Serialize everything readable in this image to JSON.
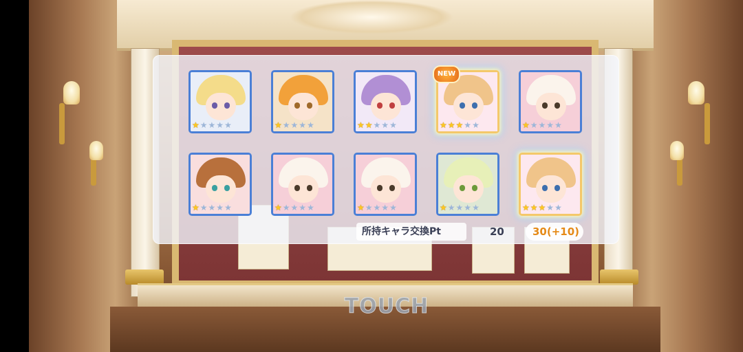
{
  "colors": {
    "card_border_blue": "#4a7fd6",
    "card_border_rainbow": "#f4c86a",
    "star_on": "#ffc81f",
    "star_off": "#9db6d8",
    "pt_after_color": "#e58a18"
  },
  "cards": [
    {
      "name": "blonde-elf-girl",
      "hair": "#f4dc8a",
      "bg": "#e9eef8",
      "eye": "#6b5ca8",
      "stars": 1,
      "rainbow": false,
      "new": false
    },
    {
      "name": "orange-haired-girl",
      "hair": "#f2a13a",
      "bg": "#f5e3c8",
      "eye": "#a06a2a",
      "stars": 1,
      "rainbow": false,
      "new": false
    },
    {
      "name": "purple-haired-girl",
      "hair": "#b18fd4",
      "bg": "#f2e9f7",
      "eye": "#c04040",
      "stars": 2,
      "rainbow": false,
      "new": false
    },
    {
      "name": "strawberry-blonde-girl",
      "hair": "#f0c48a",
      "bg": "#fde8ef",
      "eye": "#3d6fae",
      "stars": 3,
      "rainbow": true,
      "new": true
    },
    {
      "name": "alpaca-pink-bow",
      "hair": "#fbf4ec",
      "bg": "#f6cfd8",
      "eye": "#4a3a2a",
      "stars": 1,
      "rainbow": false,
      "new": false
    },
    {
      "name": "brown-haired-girl",
      "hair": "#b8703c",
      "bg": "#f9dede",
      "eye": "#3aa0a0",
      "stars": 1,
      "rainbow": false,
      "new": false
    },
    {
      "name": "alpaca-pink-bow",
      "hair": "#fbf4ec",
      "bg": "#f6cfd8",
      "eye": "#4a3a2a",
      "stars": 1,
      "rainbow": false,
      "new": false
    },
    {
      "name": "alpaca-pink-bow",
      "hair": "#fbf4ec",
      "bg": "#f6cfd8",
      "eye": "#4a3a2a",
      "stars": 1,
      "rainbow": false,
      "new": false
    },
    {
      "name": "green-hat-girl",
      "hair": "#e7f0b8",
      "bg": "#dfe8d4",
      "eye": "#6c9a3a",
      "stars": 1,
      "rainbow": false,
      "new": false
    },
    {
      "name": "strawberry-blonde-girl",
      "hair": "#f0c48a",
      "bg": "#fde8ef",
      "eye": "#3d6fae",
      "stars": 3,
      "rainbow": true,
      "new": false
    }
  ],
  "new_badge": "NEW",
  "exchange_pt": {
    "label": "所持キャラ交換Pt",
    "current": "20",
    "after": "30(+10)"
  },
  "touch_label": "TOUCH"
}
